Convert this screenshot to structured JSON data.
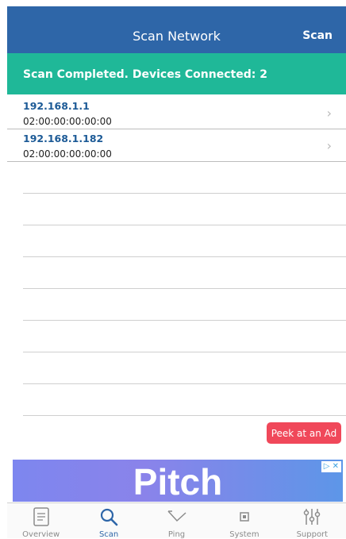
{
  "nav": {
    "title": "Scan Network",
    "scan_label": "Scan"
  },
  "status": {
    "text": "Scan Completed. Devices Connected:  2"
  },
  "devices": [
    {
      "ip": "192.168.1.1",
      "mac": "02:00:00:00:00:00"
    },
    {
      "ip": "192.168.1.182",
      "mac": "02:00:00:00:00:00"
    }
  ],
  "peek": {
    "label": "Peek at an Ad"
  },
  "ad": {
    "brand": "Pitch",
    "choice": "▷ ✕"
  },
  "tabs": [
    {
      "label": "Overview",
      "icon": "document-icon"
    },
    {
      "label": "Scan",
      "icon": "magnifier-icon"
    },
    {
      "label": "Ping",
      "icon": "ping-icon"
    },
    {
      "label": "System",
      "icon": "chip-icon"
    },
    {
      "label": "Support",
      "icon": "sliders-icon"
    }
  ],
  "colors": {
    "nav": "#2e66a8",
    "status": "#1fb898",
    "peek": "#f0485a",
    "active_tab": "#2e66a8"
  }
}
